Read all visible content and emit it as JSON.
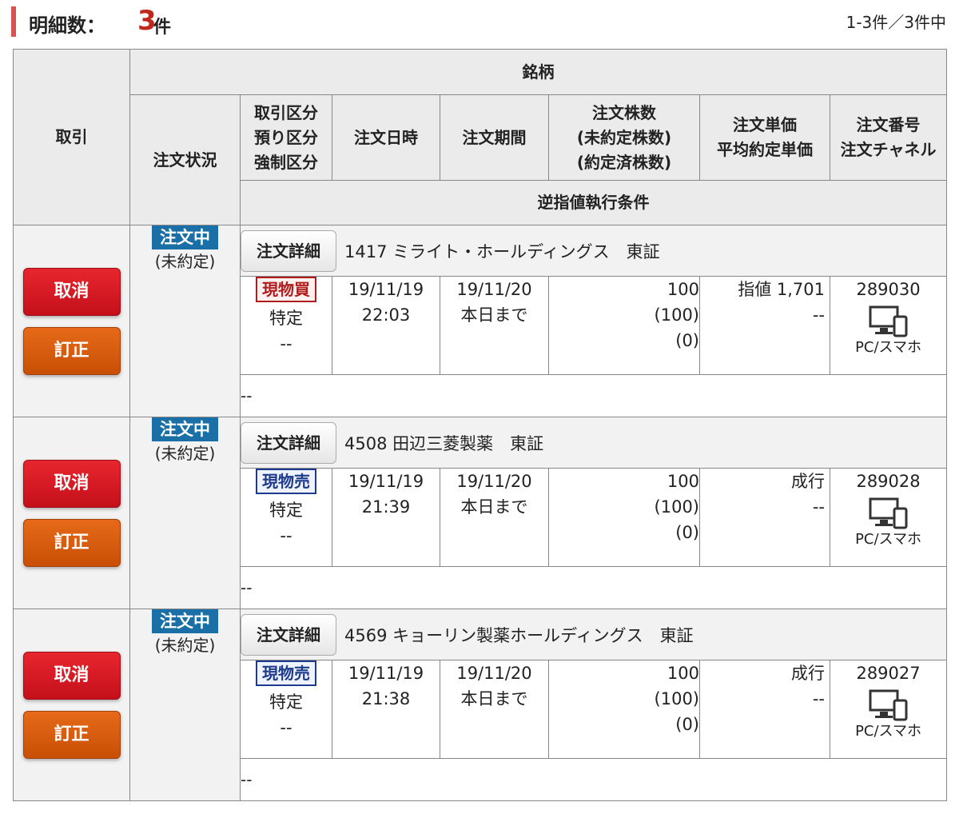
{
  "header": {
    "title_label": "明細数：",
    "count": "3",
    "count_unit": "件",
    "pager": "1-3件／3件中"
  },
  "columns": {
    "trade": "取引",
    "brand": "銘柄",
    "status": "注文状況",
    "kubun": [
      "取引区分",
      "預り区分",
      "強制区分"
    ],
    "date": "注文日時",
    "period": "注文期間",
    "qty": [
      "注文株数",
      "(未約定株数)",
      "(約定済株数)"
    ],
    "price": [
      "注文単価",
      "平均約定単価"
    ],
    "number": [
      "注文番号",
      "注文チャネル"
    ],
    "condition": "逆指値執行条件"
  },
  "buttons": {
    "cancel": "取消",
    "modify": "訂正",
    "detail": "注文詳細"
  },
  "orders": [
    {
      "stock": "1417 ミライト・ホールディングス　東証",
      "status": "注文中",
      "status_sub": "(未約定)",
      "kubun": "現物買",
      "kubun_type": "buy",
      "azukari": "特定",
      "kyosei": "--",
      "date": "19/11/19",
      "time": "22:03",
      "period": "19/11/20",
      "period_sub": "本日まで",
      "qty": "100",
      "qty_unfilled": "(100)",
      "qty_filled": "(0)",
      "price": "指値 1,701",
      "avg_price": "--",
      "number": "289030",
      "channel": "PC/スマホ",
      "channel_icon": "pc-smartphone-icon",
      "condition": "--"
    },
    {
      "stock": "4508 田辺三菱製薬　東証",
      "status": "注文中",
      "status_sub": "(未約定)",
      "kubun": "現物売",
      "kubun_type": "sell",
      "azukari": "特定",
      "kyosei": "--",
      "date": "19/11/19",
      "time": "21:39",
      "period": "19/11/20",
      "period_sub": "本日まで",
      "qty": "100",
      "qty_unfilled": "(100)",
      "qty_filled": "(0)",
      "price": "成行",
      "avg_price": "--",
      "number": "289028",
      "channel": "PC/スマホ",
      "channel_icon": "pc-smartphone-icon",
      "condition": "--"
    },
    {
      "stock": "4569 キョーリン製薬ホールディングス　東証",
      "status": "注文中",
      "status_sub": "(未約定)",
      "kubun": "現物売",
      "kubun_type": "sell",
      "azukari": "特定",
      "kyosei": "--",
      "date": "19/11/19",
      "time": "21:38",
      "period": "19/11/20",
      "period_sub": "本日まで",
      "qty": "100",
      "qty_unfilled": "(100)",
      "qty_filled": "(0)",
      "price": "成行",
      "avg_price": "--",
      "number": "289027",
      "channel": "PC/スマホ",
      "channel_icon": "pc-smartphone-icon",
      "condition": "--"
    }
  ],
  "colors": {
    "accent": "#d9534f",
    "count": "#c0281b",
    "cancel": "#d01620",
    "modify": "#d85c0e",
    "status": "#1a6fa6",
    "buy": "#b01c1c",
    "sell": "#1d3a8c"
  }
}
